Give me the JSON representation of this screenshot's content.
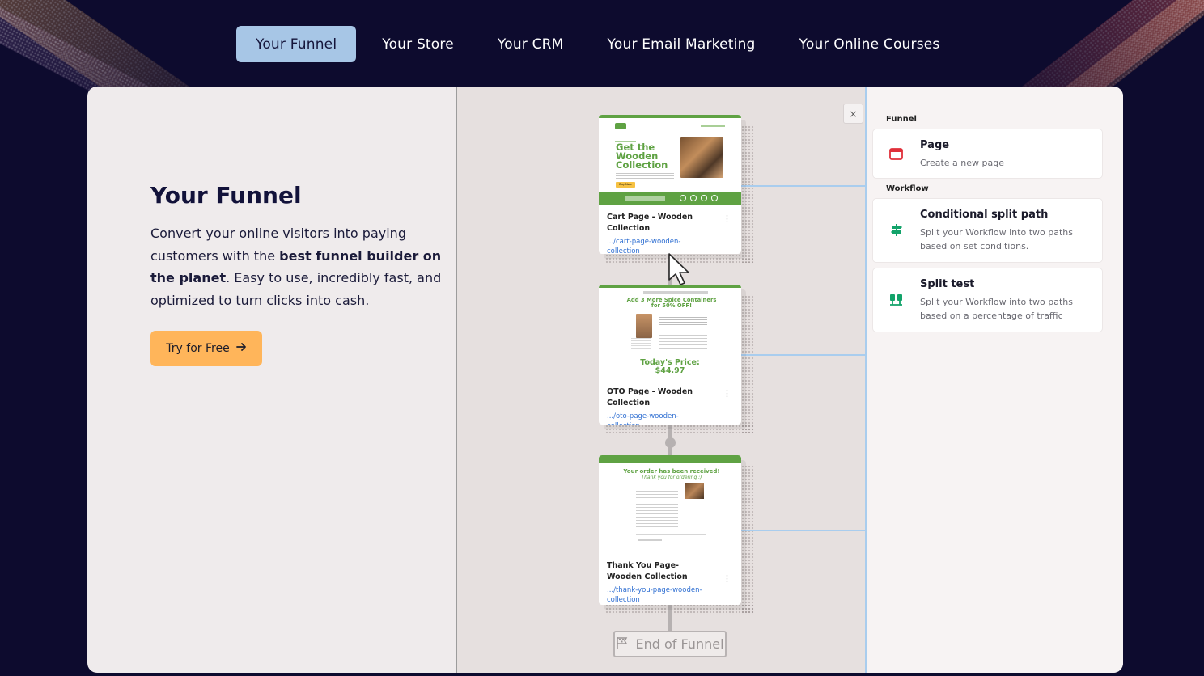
{
  "nav": {
    "tabs": [
      {
        "label": "Your Funnel",
        "active": true
      },
      {
        "label": "Your Store",
        "active": false
      },
      {
        "label": "Your CRM",
        "active": false
      },
      {
        "label": "Your Email Marketing",
        "active": false
      },
      {
        "label": "Your Online Courses",
        "active": false
      }
    ]
  },
  "hero": {
    "title": "Your Funnel",
    "text_before": "Convert your online visitors into paying customers with the ",
    "text_bold": "best funnel builder on the planet",
    "text_after": ". Easy to use, incredibly fast, and optimized to turn clicks into cash.",
    "cta_label": "Try for Free",
    "cta_icon": "arrow-right-icon"
  },
  "canvas": {
    "close_label": "×",
    "pages": [
      {
        "title": "Cart Page - Wooden Collection",
        "link": ".../cart-page-wooden-collection",
        "thumb_headline": "Get the Wooden Collection",
        "thumb_button": "Buy Now"
      },
      {
        "title": "OTO Page - Wooden Collection",
        "link": ".../oto-page-wooden-collection",
        "thumb_headline": "Add 3 More Spice Containers for 50% OFF!",
        "thumb_price": "Today's Price: $44.97"
      },
      {
        "title": "Thank You Page- Wooden Collection",
        "link": ".../thank-you-page-wooden-collection",
        "thumb_headline": "Your order has been received!",
        "thumb_sub": "Thank you for ordering :)"
      }
    ],
    "end_label": "End of Funnel",
    "end_icon": "flag-icon"
  },
  "panel": {
    "funnel_label": "Funnel",
    "workflow_label": "Workflow",
    "options": [
      {
        "title": "Page",
        "subtitle": "Create a new page",
        "icon": "page-icon",
        "color": "#e0303a"
      },
      {
        "title": "Conditional split path",
        "subtitle": "Split your Workflow into two paths based on set conditions.",
        "icon": "signpost-icon",
        "color": "#12a36a"
      },
      {
        "title": "Split test",
        "subtitle": "Split your Workflow into two paths based on a percentage of traffic",
        "icon": "split-test-icon",
        "color": "#12a36a"
      }
    ]
  },
  "colors": {
    "background": "#0d0b2e",
    "active_tab": "#a7c6e6",
    "cta": "#ffb55a",
    "funnel_green": "#5fa243",
    "link_blue": "#2f6fd2"
  }
}
